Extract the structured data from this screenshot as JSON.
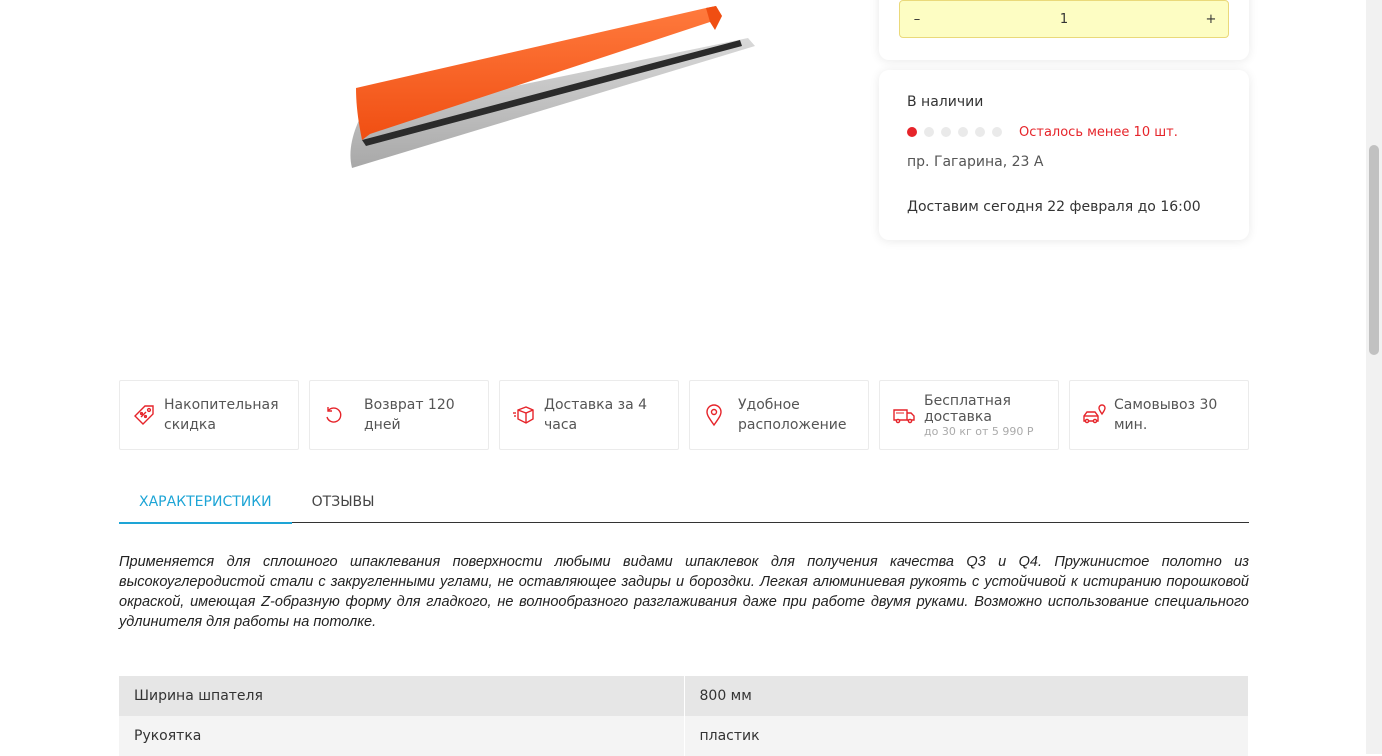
{
  "product": {
    "image_icon": "trowel-spatula-image",
    "quantity": "1",
    "qty_minus": "–",
    "qty_plus": "+"
  },
  "stock": {
    "title": "В наличии",
    "level": "1 of 6",
    "warning": "Осталось менее 10 шт.",
    "address": "пр. Гагарина, 23 А",
    "delivery": "Доставим сегодня 22 февраля до 16:00"
  },
  "features": [
    {
      "icon": "discount-tag-icon",
      "label": "Накопительная скидка",
      "sub": ""
    },
    {
      "icon": "return-arrow-icon",
      "label": "Возврат 120 дней",
      "sub": ""
    },
    {
      "icon": "box-delivery-icon",
      "label": "Доставка за 4 часа",
      "sub": ""
    },
    {
      "icon": "location-pin-icon",
      "label": "Удобное расположение",
      "sub": ""
    },
    {
      "icon": "free-delivery-truck-icon",
      "label": "Бесплатная доставка",
      "sub": "до 30 кг от 5 990 Р"
    },
    {
      "icon": "pickup-car-icon",
      "label": "Самовывоз 30 мин.",
      "sub": ""
    }
  ],
  "tabs": [
    {
      "label": "ХАРАКТЕРИСТИКИ",
      "active": true
    },
    {
      "label": "ОТЗЫВЫ",
      "active": false
    }
  ],
  "description": "Применяется для сплошного шпаклевания поверхности любыми видами шпаклевок для получения качества Q3 и Q4. Пружинистое полотно из высокоуглеродистой стали с закругленными углами, не оставляющее задиры и бороздки. Легкая алюминиевая рукоять с устойчивой к истиранию порошковой окраской, имеющая Z-образную форму для гладкого, не волнообразного разглаживания даже при работе двумя руками. Возможно использование специального удлинителя для работы на потолке.",
  "specs": [
    {
      "name": "Ширина шпателя",
      "value": "800 мм"
    },
    {
      "name": "Рукоятка",
      "value": "пластик"
    }
  ],
  "colors": {
    "accent": "#1ea5d6",
    "warning": "#e6242a",
    "qty_bg": "#fdfdc3",
    "handle": "#ff5a1f"
  }
}
